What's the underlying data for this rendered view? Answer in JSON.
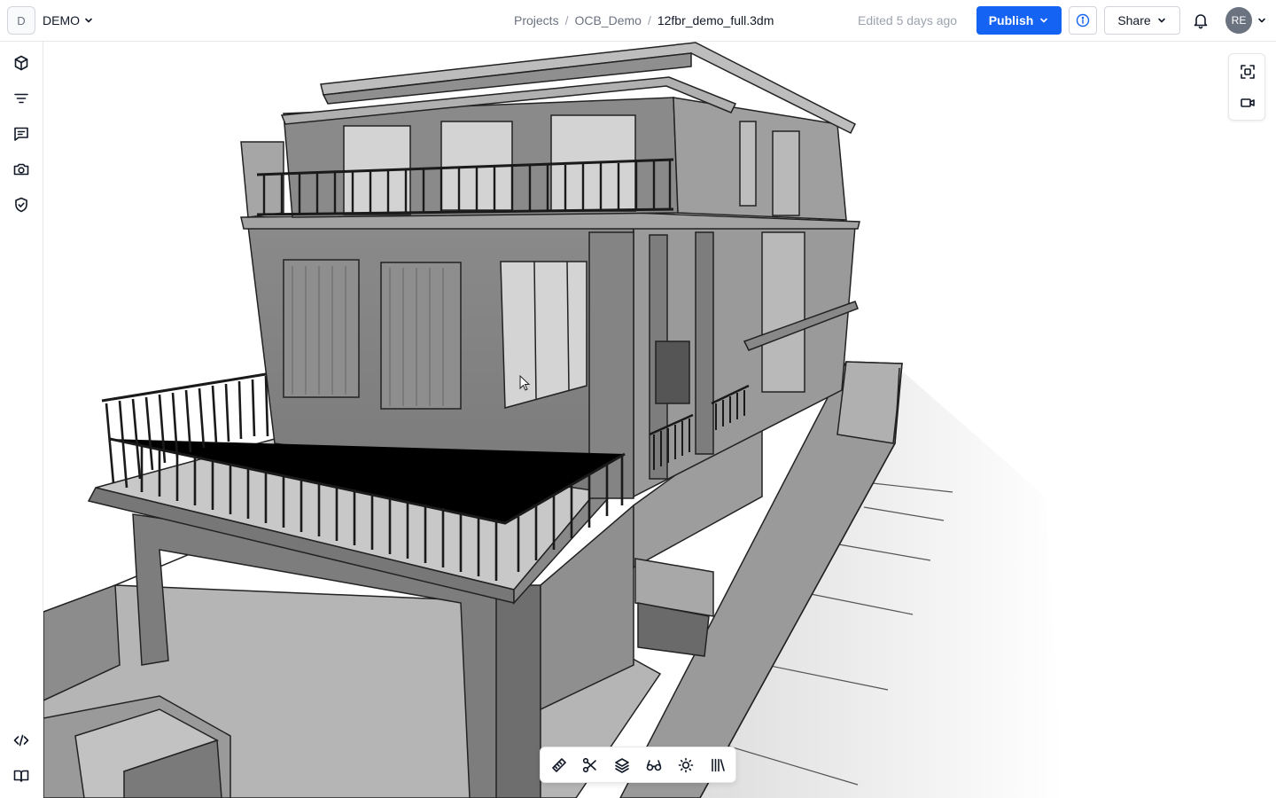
{
  "workspace": {
    "initial": "D",
    "name": "DEMO"
  },
  "breadcrumb": {
    "items": [
      "Projects",
      "OCB_Demo"
    ],
    "separator": "/",
    "current": "12fbr_demo_full.3dm"
  },
  "status": {
    "edited": "Edited 5 days ago"
  },
  "header": {
    "publish_label": "Publish",
    "share_label": "Share",
    "user_initials": "RE"
  },
  "colors": {
    "accent": "#1463f3",
    "border": "#e5e7eb",
    "avatar_bg": "#6b7280"
  },
  "left_rail": {
    "top_icons": [
      "cube-icon",
      "filter-icon",
      "comments-icon",
      "camera-icon",
      "shield-check-icon"
    ],
    "bottom_icons": [
      "code-icon",
      "book-icon"
    ]
  },
  "view_tools": [
    "frame-icon",
    "video-icon"
  ],
  "bottom_toolbar": [
    "measure-icon",
    "section-scissors-icon",
    "layers-icon",
    "explode-glasses-icon",
    "light-icon",
    "library-icon"
  ],
  "viewport": {
    "content": "3D model of a three-storey house with balconies, railings and garage"
  }
}
